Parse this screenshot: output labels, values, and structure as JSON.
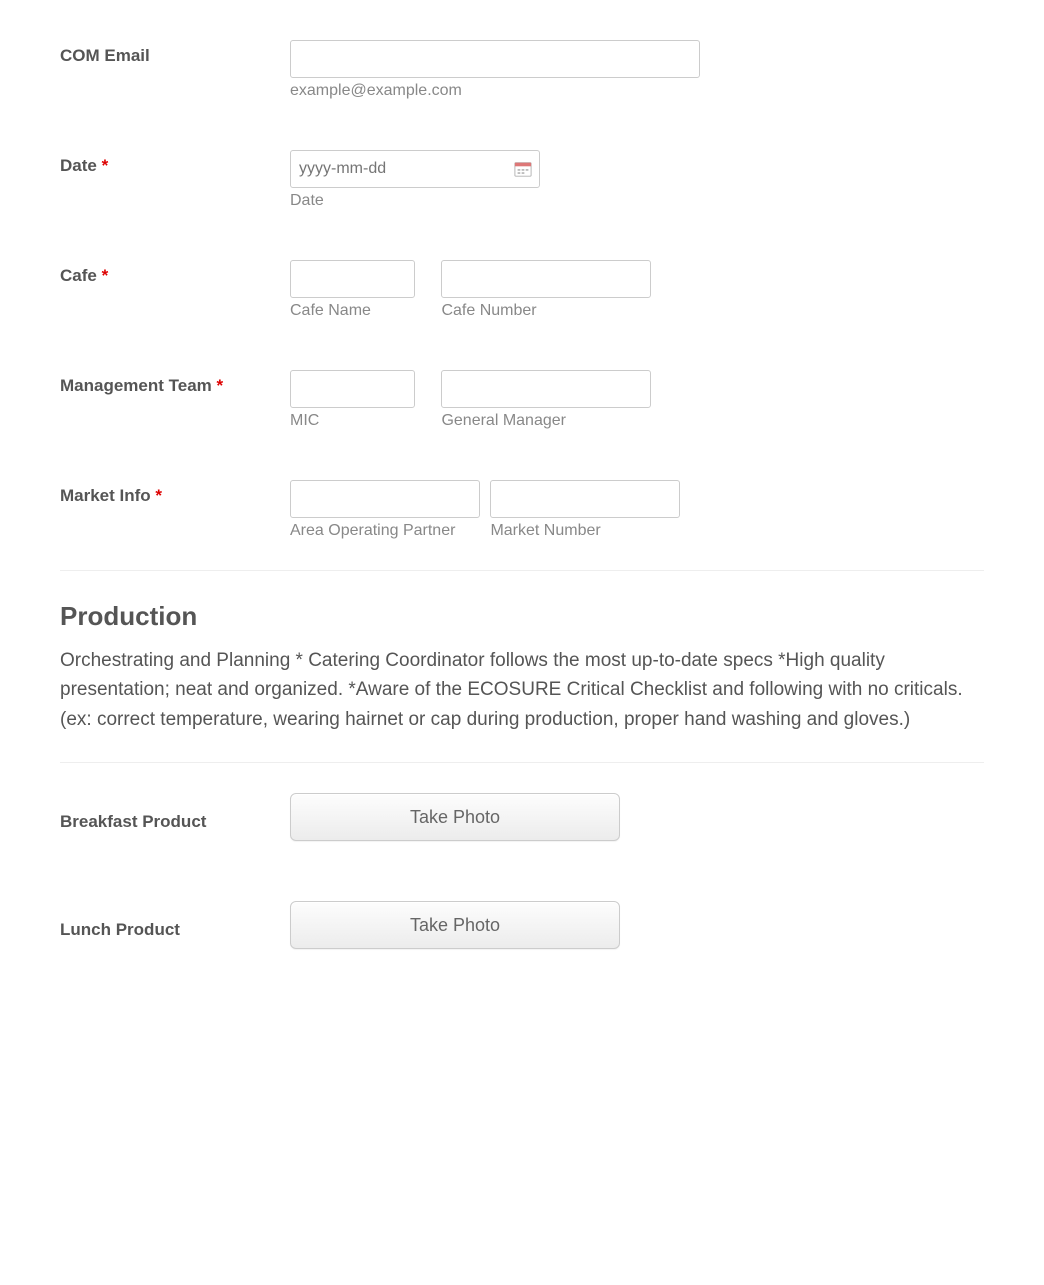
{
  "fields": {
    "com_email": {
      "label": "COM Email",
      "sublabel": "example@example.com"
    },
    "date": {
      "label": "Date",
      "placeholder": "yyyy-mm-dd",
      "sublabel": "Date"
    },
    "cafe": {
      "label": "Cafe",
      "name_sub": "Cafe Name",
      "number_sub": "Cafe Number"
    },
    "team": {
      "label": "Management Team",
      "mic_sub": "MIC",
      "gm_sub": "General Manager"
    },
    "market": {
      "label": "Market Info",
      "aop_sub": "Area Operating Partner",
      "mn_sub": "Market Number"
    }
  },
  "required_mark": "*",
  "section": {
    "heading": "Production",
    "description": " Orchestrating and Planning   * Catering Coordinator follows the most up-to-date specs *High quality presentation; neat and organized. *Aware of the ECOSURE Critical Checklist and following with no criticals. (ex: correct temperature, wearing hairnet or cap during production, proper hand washing and gloves.)"
  },
  "photos": {
    "breakfast_label": "Breakfast Product",
    "lunch_label": "Lunch Product",
    "button_label": "Take Photo"
  }
}
